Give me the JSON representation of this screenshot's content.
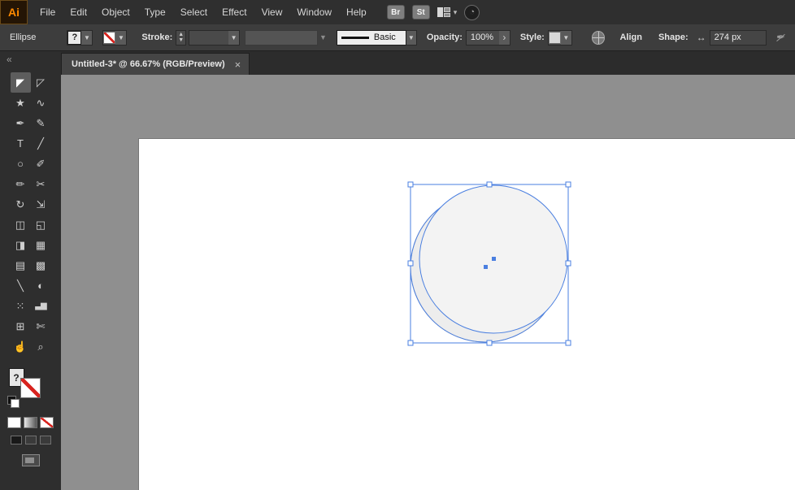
{
  "menubar": {
    "logo": "Ai",
    "items": [
      "File",
      "Edit",
      "Object",
      "Type",
      "Select",
      "Effect",
      "View",
      "Window",
      "Help"
    ],
    "br_button": "Br",
    "st_button": "St",
    "workspace_chevron": "▾",
    "gauge_glyph": "◔"
  },
  "control_bar": {
    "context_label": "Ellipse",
    "fill_variant_glyph": "?",
    "stroke_label": "Stroke:",
    "stepper_up": "▲",
    "stepper_down": "▼",
    "chevron": "▼",
    "stroke_style_label": "Basic",
    "opacity_label": "Opacity:",
    "opacity_value": "100%",
    "opacity_arrow": "›",
    "style_label": "Style:",
    "align_label": "Align",
    "shape_label": "Shape:",
    "width_icon_glyph": "↔",
    "shape_width_value": "274 px",
    "pen_disabled_glyph": "✒"
  },
  "tab": {
    "title": "Untitled-3* @ 66.67% (RGB/Preview)",
    "close_glyph": "×"
  },
  "toolbar": {
    "collapse_glyph": "«",
    "fill_question": "?",
    "tools": [
      {
        "name": "selection-tool",
        "glyph": "◤"
      },
      {
        "name": "direct-selection-tool",
        "glyph": "◸"
      },
      {
        "name": "magic-wand-tool",
        "glyph": "★"
      },
      {
        "name": "lasso-tool",
        "glyph": "∿"
      },
      {
        "name": "pen-tool",
        "glyph": "✒"
      },
      {
        "name": "curvature-tool",
        "glyph": "✎"
      },
      {
        "name": "type-tool",
        "glyph": "T"
      },
      {
        "name": "line-segment-tool",
        "glyph": "╱"
      },
      {
        "name": "ellipse-tool",
        "glyph": "○"
      },
      {
        "name": "paintbrush-tool",
        "glyph": "✐"
      },
      {
        "name": "pencil-tool",
        "glyph": "✏"
      },
      {
        "name": "scissors-tool",
        "glyph": "✂"
      },
      {
        "name": "rotate-tool",
        "glyph": "↻"
      },
      {
        "name": "scale-tool",
        "glyph": "⇲"
      },
      {
        "name": "width-tool",
        "glyph": "◫"
      },
      {
        "name": "free-transform-tool",
        "glyph": "◱"
      },
      {
        "name": "shape-builder-tool",
        "glyph": "◨"
      },
      {
        "name": "perspective-grid-tool",
        "glyph": "▦"
      },
      {
        "name": "mesh-tool",
        "glyph": "▤"
      },
      {
        "name": "gradient-tool",
        "glyph": "▩"
      },
      {
        "name": "eyedropper-tool",
        "glyph": "╲"
      },
      {
        "name": "blend-tool",
        "glyph": "◐"
      },
      {
        "name": "symbol-sprayer-tool",
        "glyph": "⁙"
      },
      {
        "name": "column-graph-tool",
        "glyph": "▃▆"
      },
      {
        "name": "artboard-tool",
        "glyph": "⊞"
      },
      {
        "name": "slice-tool",
        "glyph": "✄"
      },
      {
        "name": "hand-tool",
        "glyph": "☝"
      },
      {
        "name": "zoom-tool",
        "glyph": "⌕"
      }
    ]
  },
  "colors": {
    "selection_blue": "#4a7fe0",
    "canvas_gray": "#8f8f8f",
    "artboard_white": "#ffffff",
    "ellipse_fill": "#efefef",
    "none_red": "#d8241f"
  }
}
